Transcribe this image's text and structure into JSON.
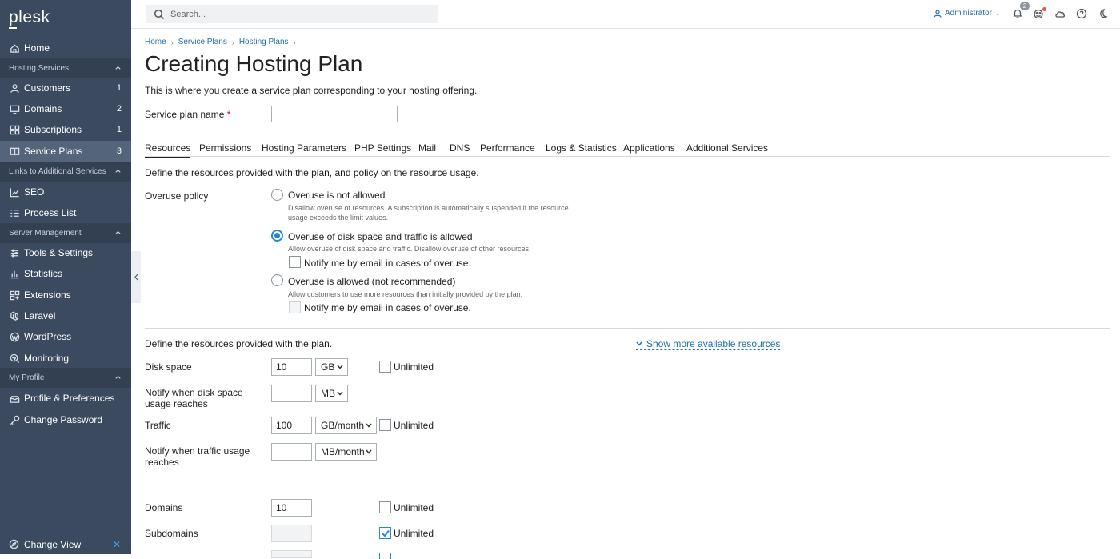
{
  "app": {
    "logo": "plesk"
  },
  "sidebar": {
    "items": [
      {
        "label": "Home",
        "icon": "home-icon"
      },
      {
        "label": "Customers",
        "count": "1",
        "icon": "user-icon"
      },
      {
        "label": "Domains",
        "count": "2",
        "icon": "monitor-icon"
      },
      {
        "label": "Subscriptions",
        "count": "1",
        "icon": "grid-icon"
      },
      {
        "label": "Service Plans",
        "count": "3",
        "icon": "book-icon"
      },
      {
        "label": "SEO",
        "icon": "chart-line-icon"
      },
      {
        "label": "Process List",
        "icon": "list-icon"
      },
      {
        "label": "Tools & Settings",
        "icon": "tools-icon"
      },
      {
        "label": "Statistics",
        "icon": "bar-chart-icon"
      },
      {
        "label": "Extensions",
        "icon": "extensions-icon"
      },
      {
        "label": "Laravel",
        "icon": "laravel-icon"
      },
      {
        "label": "WordPress",
        "icon": "wordpress-icon"
      },
      {
        "label": "Monitoring",
        "icon": "monitoring-icon"
      },
      {
        "label": "Profile & Preferences",
        "icon": "profile-icon"
      },
      {
        "label": "Change Password",
        "icon": "key-icon"
      }
    ],
    "groups": [
      "Hosting Services",
      "Links to Additional Services",
      "Server Management",
      "My Profile"
    ],
    "change_view": "Change View"
  },
  "header": {
    "search_placeholder": "Search...",
    "user": "Administrator",
    "notifications_count": "2"
  },
  "breadcrumb": [
    "Home",
    "Service Plans",
    "Hosting Plans"
  ],
  "page": {
    "title": "Creating Hosting Plan",
    "intro": "This is where you create a service plan corresponding to your hosting offering.",
    "plan_name_label": "Service plan name",
    "required_mark": "*",
    "plan_name_value": ""
  },
  "tabs": [
    "Resources",
    "Permissions",
    "Hosting Parameters",
    "PHP Settings",
    "Mail",
    "DNS",
    "Performance",
    "Logs & Statistics",
    "Applications",
    "Additional Services"
  ],
  "resources": {
    "description": "Define the resources provided with the plan, and policy on the resource usage.",
    "overuse_label": "Overuse policy",
    "options": [
      {
        "label": "Overuse is not allowed",
        "hint": "Disallow overuse of resources. A subscription is automatically suspended if the resource usage exceeds the limit values."
      },
      {
        "label": "Overuse of disk space and traffic is allowed",
        "hint": "Allow overuse of disk space and traffic. Disallow overuse of other resources.",
        "notify": "Notify me by email in cases of overuse."
      },
      {
        "label": "Overuse is allowed (not recommended)",
        "hint": "Allow customers to use more resources than initially provided by the plan.",
        "notify": "Notify me by email in cases of overuse."
      }
    ],
    "define_label": "Define the resources provided with the plan.",
    "show_more": "Show more available resources",
    "unlimited": "Unlimited",
    "fields": {
      "disk_space": {
        "label": "Disk space",
        "value": "10",
        "unit": "GB"
      },
      "disk_notify": {
        "label": "Notify when disk space usage reaches",
        "value": "",
        "unit": "MB"
      },
      "traffic": {
        "label": "Traffic",
        "value": "100",
        "unit": "GB/month"
      },
      "traffic_notify": {
        "label": "Notify when traffic usage reaches",
        "value": "",
        "unit": "MB/month"
      },
      "domains": {
        "label": "Domains",
        "value": "10"
      },
      "subdomains": {
        "label": "Subdomains",
        "value": ""
      }
    }
  }
}
